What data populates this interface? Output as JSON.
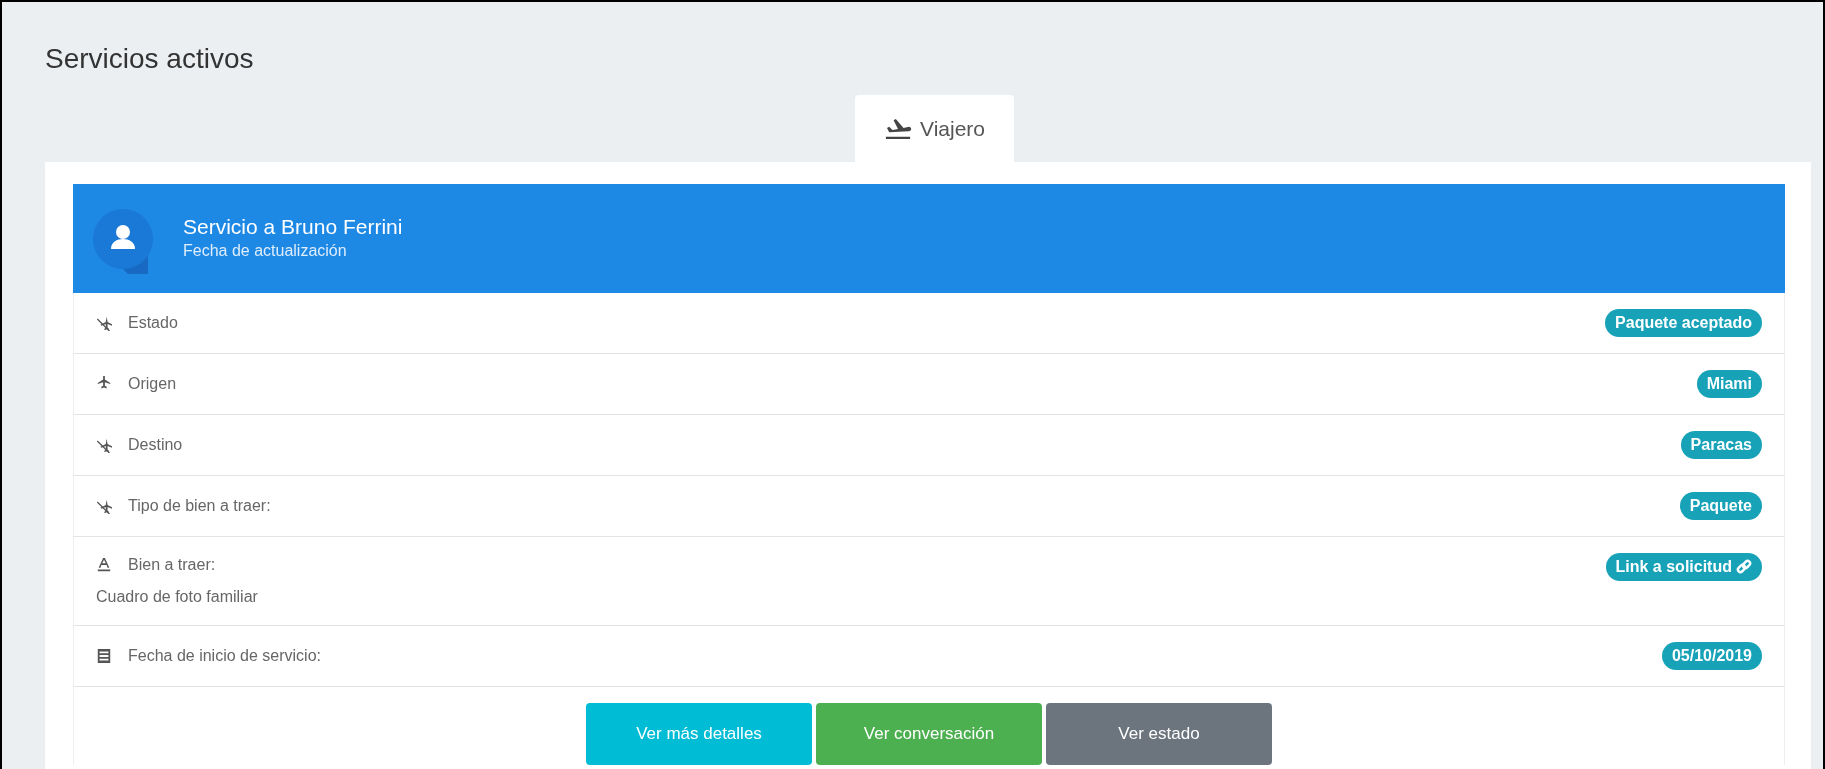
{
  "page_title": "Servicios activos",
  "tabs": [
    {
      "label": "Viajero",
      "selected": true
    }
  ],
  "service": {
    "title": "Servicio a Bruno Ferrini",
    "subtitle": "Fecha de actualización",
    "rows": [
      {
        "label": "Estado",
        "value": "Paquete aceptado",
        "kind": "badge"
      },
      {
        "label": "Origen",
        "value": "Miami",
        "kind": "badge"
      },
      {
        "label": "Destino",
        "value": "Paracas",
        "kind": "badge"
      },
      {
        "label": "Tipo de bien a traer:",
        "value": "Paquete",
        "kind": "badge"
      },
      {
        "label": "Bien a traer:",
        "detail": "Cuadro de foto familiar",
        "value": "Link a solicitud",
        "kind": "link"
      },
      {
        "label": "Fecha de inicio de servicio:",
        "value": "05/10/2019",
        "kind": "badge"
      }
    ],
    "buttons": [
      {
        "label": "Ver más detalles",
        "color": "#00bcd4"
      },
      {
        "label": "Ver conversación",
        "color": "#4caf50"
      },
      {
        "label": "Ver estado",
        "color": "#6c757d"
      }
    ]
  }
}
